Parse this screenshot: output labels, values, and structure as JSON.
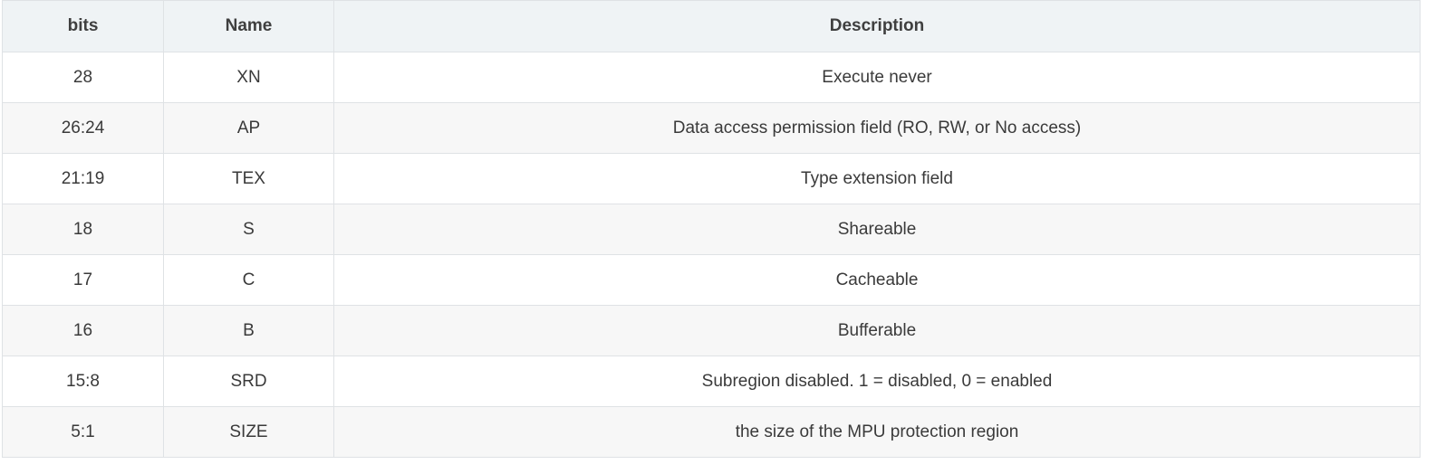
{
  "table": {
    "headers": {
      "bits": "bits",
      "name": "Name",
      "description": "Description"
    },
    "rows": [
      {
        "bits": "28",
        "name": "XN",
        "description": "Execute never"
      },
      {
        "bits": "26:24",
        "name": "AP",
        "description": "Data access permission field (RO, RW, or No access)"
      },
      {
        "bits": "21:19",
        "name": "TEX",
        "description": "Type extension field"
      },
      {
        "bits": "18",
        "name": "S",
        "description": "Shareable"
      },
      {
        "bits": "17",
        "name": "C",
        "description": "Cacheable"
      },
      {
        "bits": "16",
        "name": "B",
        "description": "Bufferable"
      },
      {
        "bits": "15:8",
        "name": "SRD",
        "description": "Subregion disabled. 1 = disabled, 0 = enabled"
      },
      {
        "bits": "5:1",
        "name": "SIZE",
        "description": "the size of the MPU protection region"
      }
    ]
  }
}
